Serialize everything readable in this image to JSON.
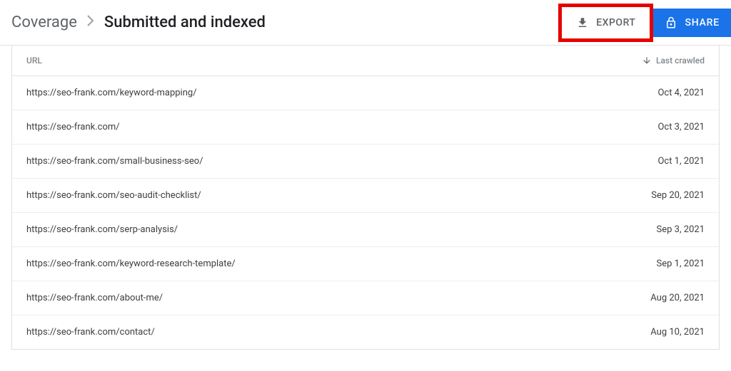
{
  "breadcrumb": {
    "parent": "Coverage",
    "current": "Submitted and indexed"
  },
  "actions": {
    "export_label": "EXPORT",
    "share_label": "SHARE"
  },
  "table": {
    "header_url": "URL",
    "header_crawled": "Last crawled",
    "rows": [
      {
        "url": "https://seo-frank.com/keyword-mapping/",
        "date": "Oct 4, 2021"
      },
      {
        "url": "https://seo-frank.com/",
        "date": "Oct 3, 2021"
      },
      {
        "url": "https://seo-frank.com/small-business-seo/",
        "date": "Oct 1, 2021"
      },
      {
        "url": "https://seo-frank.com/seo-audit-checklist/",
        "date": "Sep 20, 2021"
      },
      {
        "url": "https://seo-frank.com/serp-analysis/",
        "date": "Sep 3, 2021"
      },
      {
        "url": "https://seo-frank.com/keyword-research-template/",
        "date": "Sep 1, 2021"
      },
      {
        "url": "https://seo-frank.com/about-me/",
        "date": "Aug 20, 2021"
      },
      {
        "url": "https://seo-frank.com/contact/",
        "date": "Aug 10, 2021"
      }
    ]
  }
}
